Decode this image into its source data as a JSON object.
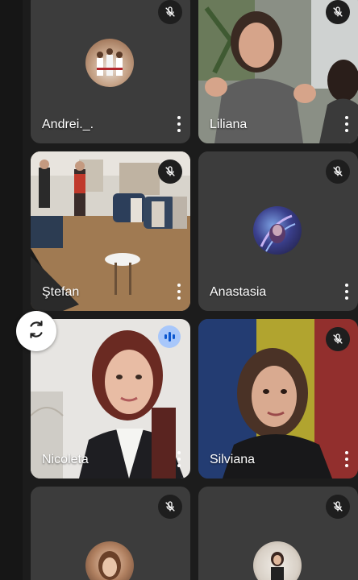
{
  "participants": [
    {
      "name": "Andrei._.",
      "muted": true,
      "video": false
    },
    {
      "name": "Liliana",
      "muted": true,
      "video": true
    },
    {
      "name": "Ştefan",
      "muted": true,
      "video": true
    },
    {
      "name": "Anastasia",
      "muted": true,
      "video": false
    },
    {
      "name": "Nicoleta",
      "muted": false,
      "speaking": true,
      "video": true
    },
    {
      "name": "Silviana",
      "muted": true,
      "video": true
    },
    {
      "name": "",
      "muted": true,
      "video": false
    },
    {
      "name": "",
      "muted": true,
      "video": false
    }
  ],
  "icons": {
    "mute": "mic-off-icon",
    "more": "more-vert-icon",
    "rotate": "rotate-camera-icon",
    "speaking": "audio-level-icon"
  },
  "colors": {
    "background": "#1c1c1c",
    "tile": "#3c3c3c",
    "speaking_badge": "#a8c7fa"
  }
}
